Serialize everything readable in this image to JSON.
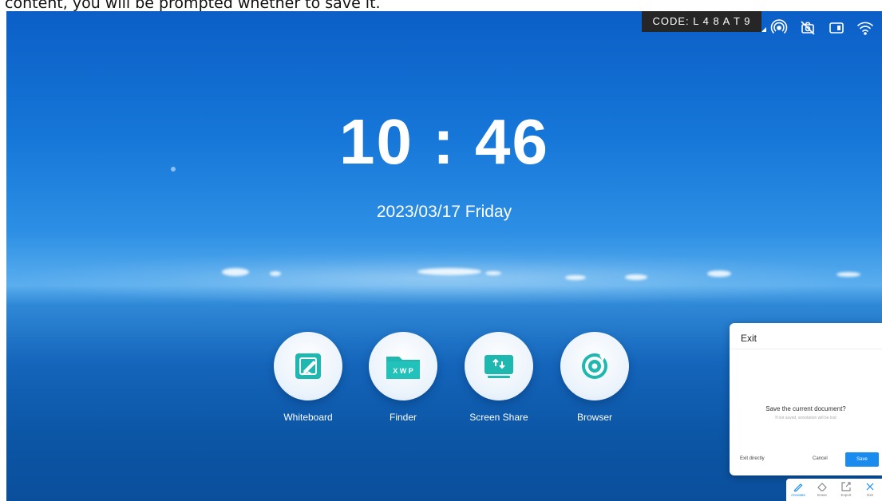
{
  "caption": "content, you will be prompted whether to save it.",
  "status_bar": {
    "code_label": "CODE: L 4 8 A T 9",
    "icons": [
      "hotspot-icon",
      "camera-off-icon",
      "screen-icon",
      "wifi-icon"
    ]
  },
  "clock": {
    "time": "10 : 46",
    "date": "2023/03/17   Friday"
  },
  "apps": [
    {
      "label": "Whiteboard",
      "icon": "whiteboard-icon"
    },
    {
      "label": "Finder",
      "icon": "finder-icon",
      "badge": "X W P"
    },
    {
      "label": "Screen Share",
      "icon": "screen-share-icon"
    },
    {
      "label": "Browser",
      "icon": "browser-icon"
    }
  ],
  "dialog": {
    "title": "Exit",
    "question": "Save the current document?",
    "subtext": "If not saved, annotation will be lost",
    "exit_directly": "Exit directly",
    "cancel": "Cancel",
    "save": "Save"
  },
  "toolbar": {
    "items": [
      {
        "label": "Annotate",
        "icon": "pen-icon",
        "active": true
      },
      {
        "label": "Erase",
        "icon": "eraser-icon"
      },
      {
        "label": "Export",
        "icon": "export-icon"
      },
      {
        "label": "Exit",
        "icon": "close-icon"
      }
    ]
  },
  "colors": {
    "accent": "#1a8cf0",
    "app_icon_teal": "#1fb8b0",
    "code_badge_bg": "#262626"
  }
}
